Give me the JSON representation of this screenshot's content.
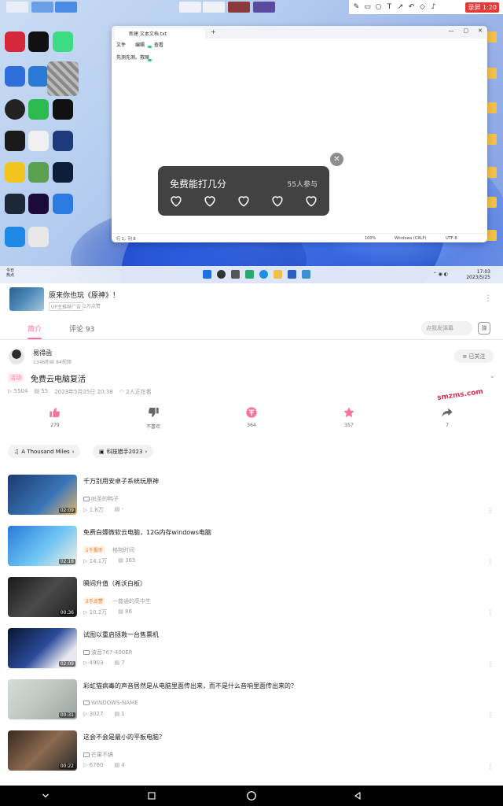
{
  "desktop": {
    "notepad": {
      "tab_title": "新建 文本文档.txt",
      "menu": [
        "文件",
        "编辑",
        "查看"
      ],
      "content": "先测先测。救赎",
      "status": {
        "position": "行 1，列 8",
        "zoom": "100%",
        "line_ending": "Windows (CRLF)",
        "encoding": "UTF-8"
      }
    },
    "rating_popup": {
      "title": "免费能打几分",
      "participants": "55人参与",
      "close": "✕"
    },
    "taskbar": {
      "news_title": "今日",
      "news_sub": "热点",
      "time": "17:03",
      "date": "2023/5/25"
    },
    "record_badge": "录屏 1:20"
  },
  "ad": {
    "title": "原来你也玩《原神》！",
    "tag": "UP主推荐广告",
    "likes": "1万点赞"
  },
  "tabs": {
    "intro": "简介",
    "comments": "评论 93",
    "danmaku_placeholder": "点我发弹幕",
    "danmaku_button": "弹"
  },
  "uploader": {
    "name": "易得函",
    "stats": "1346粉丝  84视频",
    "follow": "已关注"
  },
  "video": {
    "tag": "活动",
    "title": "免费云电脑复活",
    "views": "5504",
    "danmaku": "55",
    "date": "2023年5月25日 20:38",
    "watching": "2人正在看"
  },
  "watermark_logo": "smzms.com",
  "actions": [
    {
      "name": "like",
      "label": "279"
    },
    {
      "name": "dislike",
      "label": "不喜欢"
    },
    {
      "name": "coin",
      "label": "364"
    },
    {
      "name": "favorite",
      "label": "357"
    },
    {
      "name": "share",
      "label": "7"
    }
  ],
  "chips": {
    "bgm": "A Thousand Miles",
    "topic": "科技猎手2023"
  },
  "related": [
    {
      "title": "千万别用安卓子系统玩原神",
      "badge": "",
      "up": "吮圣的鸭子",
      "views": "1.8万",
      "danmaku": "-",
      "duration": "02:09"
    },
    {
      "title": "免费白嫖微软云电脑，12G内存windows电脑",
      "badge": "1千投币",
      "up": "格物时间",
      "views": "14.1万",
      "danmaku": "365",
      "duration": "02:18"
    },
    {
      "title": "瞬间升值（希沃白板）",
      "badge": "2千点赞",
      "up": "一普通的高中生",
      "views": "10.2万",
      "danmaku": "86",
      "duration": "00:36"
    },
    {
      "title": "试图以重启拯救一台售票机",
      "badge": "",
      "up": "波音767-400ER",
      "views": "4903",
      "danmaku": "7",
      "duration": "02:09"
    },
    {
      "title": "彩虹猫病毒的声音居然是从电脑里面传出来，而不是什么音响里面传出来的？",
      "badge": "",
      "up": "WINDOWS-NAME",
      "views": "3027",
      "danmaku": "1",
      "duration": "00:31"
    },
    {
      "title": "这会不会是最小的平板电脑？",
      "badge": "",
      "up": "芒果不搞",
      "views": "6760",
      "danmaku": "4",
      "duration": "00:22"
    }
  ],
  "colors": {
    "accent": "#fb7299",
    "muted": "#9499a0"
  }
}
